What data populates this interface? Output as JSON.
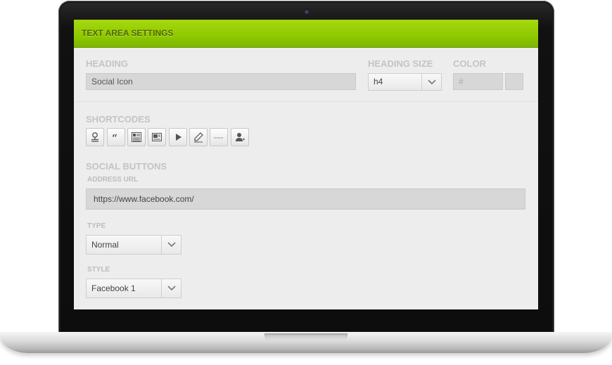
{
  "panel": {
    "title": "TEXT AREA SETTINGS"
  },
  "heading": {
    "label": "HEADING",
    "value": "Social Icon"
  },
  "heading_size": {
    "label": "HEADING SIZE",
    "value": "h4"
  },
  "color": {
    "label": "COLOR",
    "placeholder": "#"
  },
  "shortcodes": {
    "label": "SHORTCODES",
    "icons": [
      "stamp-icon",
      "quote-icon",
      "text-list-icon",
      "image-text-icon",
      "play-icon",
      "pencil-icon",
      "dotted-line-icon",
      "user-add-icon"
    ]
  },
  "social_buttons": {
    "label": "SOCIAL BUTTONS",
    "address_url_label": "ADDRESS URL",
    "address_url_value": "https://www.facebook.com/",
    "type_label": "TYPE",
    "type_value": "Normal",
    "style_label": "STYLE",
    "style_value": "Facebook 1"
  }
}
